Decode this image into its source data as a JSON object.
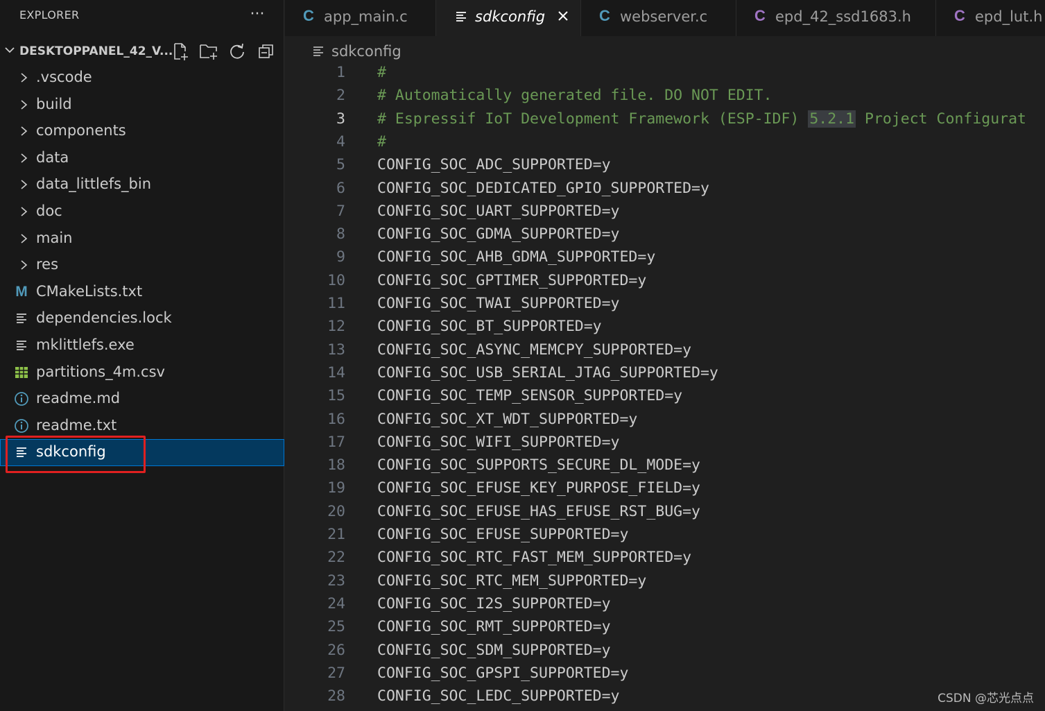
{
  "sidebar": {
    "title": "EXPLORER",
    "more_label": "···",
    "workspace": "DESKTOPPANEL_42_V...",
    "items": [
      {
        "label": ".vscode",
        "kind": "folder"
      },
      {
        "label": "build",
        "kind": "folder"
      },
      {
        "label": "components",
        "kind": "folder"
      },
      {
        "label": "data",
        "kind": "folder"
      },
      {
        "label": "data_littlefs_bin",
        "kind": "folder"
      },
      {
        "label": "doc",
        "kind": "folder"
      },
      {
        "label": "main",
        "kind": "folder"
      },
      {
        "label": "res",
        "kind": "folder"
      },
      {
        "label": "CMakeLists.txt",
        "kind": "cmake-file",
        "icon_glyph": "M"
      },
      {
        "label": "dependencies.lock",
        "kind": "text-file"
      },
      {
        "label": "mklittlefs.exe",
        "kind": "text-file"
      },
      {
        "label": "partitions_4m.csv",
        "kind": "csv-file"
      },
      {
        "label": "readme.md",
        "kind": "info-file"
      },
      {
        "label": "readme.txt",
        "kind": "info-file"
      },
      {
        "label": "sdkconfig",
        "kind": "text-file",
        "selected": true
      }
    ]
  },
  "tabs": [
    {
      "label": "app_main.c",
      "icon": "C",
      "icon_color": "#519aba"
    },
    {
      "label": "sdkconfig",
      "icon": "lines",
      "active": true
    },
    {
      "label": "webserver.c",
      "icon": "C",
      "icon_color": "#519aba"
    },
    {
      "label": "epd_42_ssd1683.h",
      "icon": "C",
      "icon_color": "#a074c4"
    },
    {
      "label": "epd_lut.h",
      "icon": "C",
      "icon_color": "#a074c4"
    }
  ],
  "breadcrumb": {
    "label": "sdkconfig"
  },
  "editor": {
    "current_line": 3,
    "lines": [
      {
        "n": "1",
        "text": "#",
        "type": "comment"
      },
      {
        "n": "2",
        "text": "# Automatically generated file. DO NOT EDIT.",
        "type": "comment"
      },
      {
        "n": "3",
        "pre": "# Espressif IoT Development Framework (ESP-IDF) ",
        "version": "5.2.1",
        "post": " Project Configurat",
        "type": "comment-version"
      },
      {
        "n": "4",
        "text": "#",
        "type": "comment"
      },
      {
        "n": "5",
        "text": "CONFIG_SOC_ADC_SUPPORTED=y"
      },
      {
        "n": "6",
        "text": "CONFIG_SOC_DEDICATED_GPIO_SUPPORTED=y"
      },
      {
        "n": "7",
        "text": "CONFIG_SOC_UART_SUPPORTED=y"
      },
      {
        "n": "8",
        "text": "CONFIG_SOC_GDMA_SUPPORTED=y"
      },
      {
        "n": "9",
        "text": "CONFIG_SOC_AHB_GDMA_SUPPORTED=y"
      },
      {
        "n": "10",
        "text": "CONFIG_SOC_GPTIMER_SUPPORTED=y"
      },
      {
        "n": "11",
        "text": "CONFIG_SOC_TWAI_SUPPORTED=y"
      },
      {
        "n": "12",
        "text": "CONFIG_SOC_BT_SUPPORTED=y"
      },
      {
        "n": "13",
        "text": "CONFIG_SOC_ASYNC_MEMCPY_SUPPORTED=y"
      },
      {
        "n": "14",
        "text": "CONFIG_SOC_USB_SERIAL_JTAG_SUPPORTED=y"
      },
      {
        "n": "15",
        "text": "CONFIG_SOC_TEMP_SENSOR_SUPPORTED=y"
      },
      {
        "n": "16",
        "text": "CONFIG_SOC_XT_WDT_SUPPORTED=y"
      },
      {
        "n": "17",
        "text": "CONFIG_SOC_WIFI_SUPPORTED=y"
      },
      {
        "n": "18",
        "text": "CONFIG_SOC_SUPPORTS_SECURE_DL_MODE=y"
      },
      {
        "n": "19",
        "text": "CONFIG_SOC_EFUSE_KEY_PURPOSE_FIELD=y"
      },
      {
        "n": "20",
        "text": "CONFIG_SOC_EFUSE_HAS_EFUSE_RST_BUG=y"
      },
      {
        "n": "21",
        "text": "CONFIG_SOC_EFUSE_SUPPORTED=y"
      },
      {
        "n": "22",
        "text": "CONFIG_SOC_RTC_FAST_MEM_SUPPORTED=y"
      },
      {
        "n": "23",
        "text": "CONFIG_SOC_RTC_MEM_SUPPORTED=y"
      },
      {
        "n": "24",
        "text": "CONFIG_SOC_I2S_SUPPORTED=y"
      },
      {
        "n": "25",
        "text": "CONFIG_SOC_RMT_SUPPORTED=y"
      },
      {
        "n": "26",
        "text": "CONFIG_SOC_SDM_SUPPORTED=y"
      },
      {
        "n": "27",
        "text": "CONFIG_SOC_GPSPI_SUPPORTED=y"
      },
      {
        "n": "28",
        "text": "CONFIG_SOC_LEDC_SUPPORTED=y"
      }
    ]
  },
  "watermark": "CSDN @芯光点点",
  "colors": {
    "accent": "#0078d4",
    "selection": "#04395e",
    "highlight_box": "#e02020",
    "comment": "#6a9955"
  }
}
